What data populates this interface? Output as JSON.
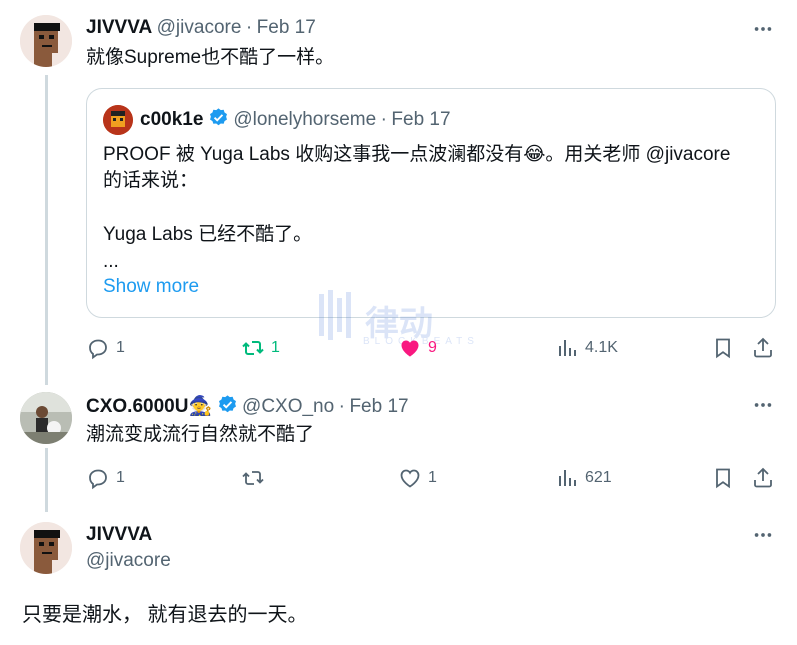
{
  "tweet1": {
    "name": "JIVVVA",
    "handle": "@jivacore",
    "sep": "·",
    "date": "Feb 17",
    "text": "就像Supreme也不酷了一样。",
    "quote": {
      "name": "c00k1e",
      "handle": "@lonelyhorseme",
      "sep": "·",
      "date": "Feb 17",
      "line1": "PROOF 被 Yuga Labs 收购这事我一点波澜都没有",
      "emoji": "😂",
      "line1b": "。用关老师 @jivacore",
      "line2": "的话来说：",
      "line3": "Yuga Labs 已经不酷了。",
      "ellipsis": "...",
      "show_more": "Show more"
    },
    "actions": {
      "replies": "1",
      "retweets": "1",
      "likes": "9",
      "views": "4.1K"
    }
  },
  "tweet2": {
    "name": "CXO.6000U",
    "name_emoji": "🧙",
    "handle": "@CXO_no",
    "sep": "·",
    "date": "Feb 17",
    "text": "潮流变成流行自然就不酷了",
    "actions": {
      "replies": "1",
      "retweets": "",
      "likes": "1",
      "views": "621"
    }
  },
  "tweet3": {
    "name": "JIVVVA",
    "handle": "@jivacore",
    "text": "只要是潮水， 就有退去的一天。"
  },
  "watermark": {
    "brand": "律动",
    "sub": "BLOCKBEATS"
  },
  "colors": {
    "retweet_active": "#00ba7c",
    "like_active": "#f91880",
    "muted": "#536471",
    "link": "#1d9bf0",
    "verified": "#1d9bf0"
  },
  "icons": [
    "more-icon",
    "verified-icon",
    "reply-icon",
    "retweet-icon",
    "like-icon",
    "views-icon",
    "bookmark-icon",
    "share-icon"
  ]
}
